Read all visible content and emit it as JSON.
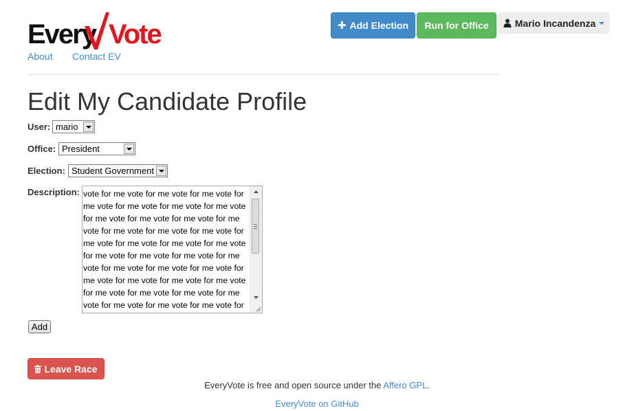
{
  "brand": {
    "part1": "Every",
    "part2": "Vote"
  },
  "nav": {
    "about": "About",
    "contact": "Contact EV"
  },
  "header": {
    "add_election_label": "Add Election",
    "run_for_office_label": "Run for Office",
    "user_menu_label": "Mario Incandenza"
  },
  "page": {
    "title": "Edit My Candidate Profile"
  },
  "form": {
    "user_label": "User:",
    "user_value": "mario",
    "office_label": "Office:",
    "office_value": "President",
    "election_label": "Election:",
    "election_value": "Student Government",
    "description_label": "Description:",
    "description_value": "vote for me vote for me vote for me vote for me vote for me vote for me vote for me vote for me vote for me vote for me vote for me vote for me vote for me vote for me vote for me vote for me vote for me vote for me vote for me vote for me vote for me vote for me vote for me vote for me vote for me vote for me vote for me vote for me vote for me vote for me vote for me vote for me vote for me vote for me vote for me vote for me vote for me vote for me vote for me vote for me vote for me vote for me vote for me vote for me vote for me vote for me vote for me vote for me vote for me vote for me vote for me vote for me vote for me vote for me vote for me vote for me",
    "add_button": "Add"
  },
  "leave_race_label": "Leave Race",
  "footer": {
    "license_prefix": "EveryVote is free and open source under the ",
    "license_link": "Affero GPL",
    "license_suffix": ".",
    "github_link": "EveryVote on GitHub"
  },
  "icons": {
    "add_election": "plus-icon",
    "user_menu": "user-icon",
    "leave_race": "trash-icon"
  },
  "colors": {
    "primary": "#428bca",
    "success": "#5cb85c",
    "danger": "#d9534f",
    "brand_red": "#e3141d"
  }
}
